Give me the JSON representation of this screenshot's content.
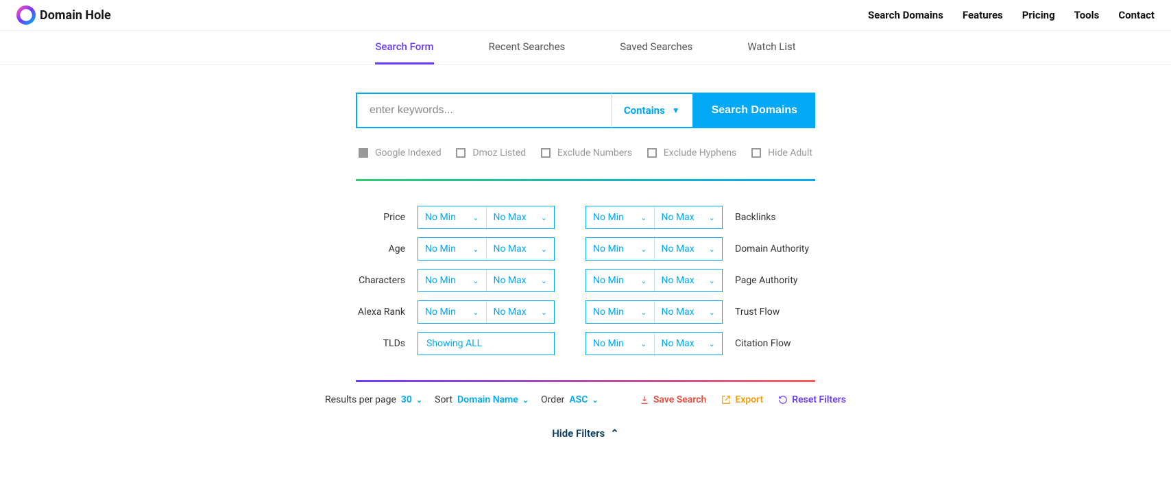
{
  "header": {
    "brand": "Domain Hole",
    "nav": [
      "Search Domains",
      "Features",
      "Pricing",
      "Tools",
      "Contact"
    ]
  },
  "tabs": [
    "Search Form",
    "Recent Searches",
    "Saved Searches",
    "Watch List"
  ],
  "search": {
    "placeholder": "enter keywords...",
    "match_mode": "Contains",
    "button": "Search Domains"
  },
  "checkboxes": [
    {
      "label": "Google Indexed",
      "checked": true
    },
    {
      "label": "Dmoz Listed",
      "checked": false
    },
    {
      "label": "Exclude Numbers",
      "checked": false
    },
    {
      "label": "Exclude Hyphens",
      "checked": false
    },
    {
      "label": "Hide Adult",
      "checked": false
    }
  ],
  "filters_left": [
    {
      "label": "Price",
      "min": "No Min",
      "max": "No Max"
    },
    {
      "label": "Age",
      "min": "No Min",
      "max": "No Max"
    },
    {
      "label": "Characters",
      "min": "No Min",
      "max": "No Max"
    },
    {
      "label": "Alexa Rank",
      "min": "No Min",
      "max": "No Max"
    }
  ],
  "filters_tld": {
    "label": "TLDs",
    "value": "Showing ALL"
  },
  "filters_right": [
    {
      "label": "Backlinks",
      "min": "No Min",
      "max": "No Max"
    },
    {
      "label": "Domain Authority",
      "min": "No Min",
      "max": "No Max"
    },
    {
      "label": "Page Authority",
      "min": "No Min",
      "max": "No Max"
    },
    {
      "label": "Trust Flow",
      "min": "No Min",
      "max": "No Max"
    },
    {
      "label": "Citation Flow",
      "min": "No Min",
      "max": "No Max"
    }
  ],
  "bottom": {
    "results_label": "Results per page",
    "results_value": "30",
    "sort_label": "Sort",
    "sort_value": "Domain Name",
    "order_label": "Order",
    "order_value": "ASC",
    "save": "Save Search",
    "export": "Export",
    "reset": "Reset Filters"
  },
  "hide_filters": "Hide Filters"
}
